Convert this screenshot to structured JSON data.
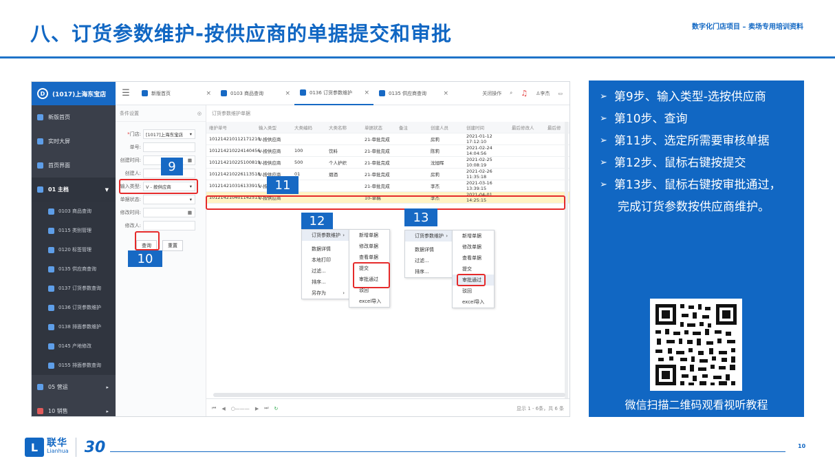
{
  "slide": {
    "title": "八、订货参数维护-按供应商的单据提交和审批",
    "subtitle": "数字化门店项目 – 卖场专用培训资料",
    "page": "10"
  },
  "sidebar": {
    "brand": "(1017)上海东宝店",
    "items": [
      {
        "label": "新版首页"
      },
      {
        "label": "实时大屏"
      },
      {
        "label": "首页界面"
      },
      {
        "label": "01 主档"
      }
    ],
    "subitems": [
      {
        "label": "0103 商品查询"
      },
      {
        "label": "0115 类别管理"
      },
      {
        "label": "0120 标签管理"
      },
      {
        "label": "0135 供应商查询"
      },
      {
        "label": "0137 订货参数查询"
      },
      {
        "label": "0136 订货参数维护"
      },
      {
        "label": "0138 排面参数维护"
      },
      {
        "label": "0145 产地修改"
      },
      {
        "label": "0155 排面参数查询"
      }
    ],
    "bottom": [
      {
        "label": "05 营运"
      },
      {
        "label": "10 销售"
      }
    ]
  },
  "topbar": {
    "tabs": [
      {
        "label": "新版首页"
      },
      {
        "label": "0103 商品查询"
      },
      {
        "label": "0136 订货参数维护"
      },
      {
        "label": "0135 供应商查询"
      }
    ],
    "ops": "关闭操作",
    "user": "李杰"
  },
  "filter": {
    "header": "条件设置",
    "store_label": "门店:",
    "store_value": "[1017]上海东宝店",
    "doc_label": "单号:",
    "created_label": "创建时间:",
    "creator_label": "创建人:",
    "type_label": "输入类型:",
    "type_value": "V - 按供应商",
    "status_label": "单据状态:",
    "modified_label": "修改时间:",
    "modifier_label": "修改人:",
    "query_btn": "查询",
    "reset_btn": "重置"
  },
  "grid": {
    "header": "订货参数维护单据",
    "columns": [
      "维护单号",
      "输入类型",
      "大类编码",
      "大类名称",
      "单据状态",
      "备注",
      "创建人员",
      "创建时间",
      "最后修改人",
      "最后修"
    ],
    "rows": [
      [
        "101214210112171210",
        "V-按供应商",
        "",
        "",
        "21-审批完成",
        "",
        "房莉",
        "2021-01-12 17:12:10",
        "",
        ""
      ],
      [
        "101214210224140456",
        "V-按供应商",
        "100",
        "饮料",
        "21-审批完成",
        "",
        "陈莉",
        "2021-02-24 14:04:56",
        "",
        ""
      ],
      [
        "101214210225100819",
        "V-按供应商",
        "500",
        "个人护织",
        "21-审批完成",
        "",
        "沈旭晖",
        "2021-02-25 10:08:19",
        "",
        ""
      ],
      [
        "101214210226113518",
        "V-按供应商",
        "01",
        "烟酒",
        "21-审批完成",
        "",
        "房莉",
        "2021-02-26 11:35:18",
        "",
        ""
      ],
      [
        "101214210316133915",
        "V-按",
        "",
        "",
        "21-审批完成",
        "",
        "李杰",
        "2021-03-16 13:39:15",
        "",
        ""
      ],
      [
        "101214210401142515",
        "V-按供应商",
        "",
        "",
        "10-草稿",
        "",
        "李杰",
        "2021-04-01 14:25:15",
        "",
        ""
      ]
    ],
    "pager_total": "显示 1 - 6条，共 6 条"
  },
  "menu1": {
    "items": [
      "订货参数维护",
      "数据详情",
      "本地打印",
      "过滤...",
      "排序...",
      "另存为"
    ]
  },
  "submenu1": {
    "items": [
      "新增单据",
      "修改单据",
      "查看单据",
      "提交",
      "审批通过",
      "驳回",
      "excel导入"
    ]
  },
  "menu2": {
    "items": [
      "订货参数维护",
      "数据详情",
      "过滤...",
      "排序..."
    ]
  },
  "submenu2": {
    "items": [
      "新增单据",
      "修改单据",
      "查看单据",
      "提交",
      "审批通过",
      "驳回",
      "excel导入"
    ]
  },
  "callouts": {
    "n9": "9",
    "n10": "10",
    "n11": "11",
    "n12": "12",
    "n13": "13"
  },
  "steps": [
    "第9步、输入类型-选按供应商",
    "第10步、查询",
    "第11步、选定所需要审核单据",
    "第12步、鼠标右键按提交",
    "第13步、鼠标右键按审批通过，",
    "完成订货参数按供应商维护。"
  ],
  "qr_caption": "微信扫描二维码观看视听教程",
  "footer": {
    "logo_char": "L",
    "brand_cn": "联华",
    "brand_en": "Lianhua",
    "anniv": "30"
  },
  "colors": {
    "primary": "#1167c3",
    "highlight": "#e52a2a",
    "sidebar": "#3a3f4a"
  }
}
